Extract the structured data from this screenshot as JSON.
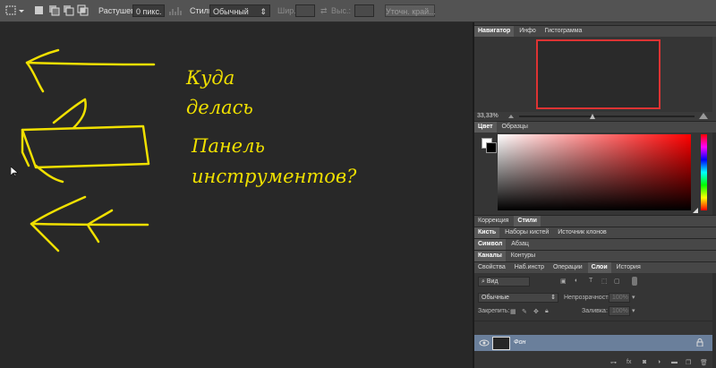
{
  "options_bar": {
    "feather_label": "Растушевка:",
    "feather_value": "0 пикс.",
    "style_label": "Стиль:",
    "style_value": "Обычный",
    "width_label": "Шир.:",
    "height_label": "Выс.:",
    "refine_button": "Уточн. край..."
  },
  "canvas": {
    "text_line1": "Куда",
    "text_line2": "делась",
    "text_line3": "Панель",
    "text_line4": "инструментов?",
    "ink_color": "#f0e000"
  },
  "navigator": {
    "tabs": [
      "Навигатор",
      "Инфо",
      "Гистограмма"
    ],
    "zoom": "33,33%"
  },
  "color_panel": {
    "tabs": [
      "Цвет",
      "Образцы"
    ]
  },
  "adjustments_panel": {
    "tabs": [
      "Коррекция",
      "Стили"
    ]
  },
  "brush_panel": {
    "tabs": [
      "Кисть",
      "Наборы кистей",
      "Источник клонов"
    ]
  },
  "char_panel": {
    "tabs": [
      "Символ",
      "Абзац"
    ]
  },
  "channels_panel": {
    "tabs": [
      "Каналы",
      "Контуры"
    ]
  },
  "layers_panel": {
    "tabs": [
      "Свойства",
      "Наб.инстр",
      "Операции",
      "Слои",
      "История"
    ],
    "filter_kind": "Вид",
    "blend_mode": "Обычные",
    "opacity_label": "Непрозрачность:",
    "opacity_value": "100%",
    "lock_label": "Закрепить:",
    "fill_label": "Заливка:",
    "fill_value": "100%",
    "layer_name": "Фон"
  }
}
